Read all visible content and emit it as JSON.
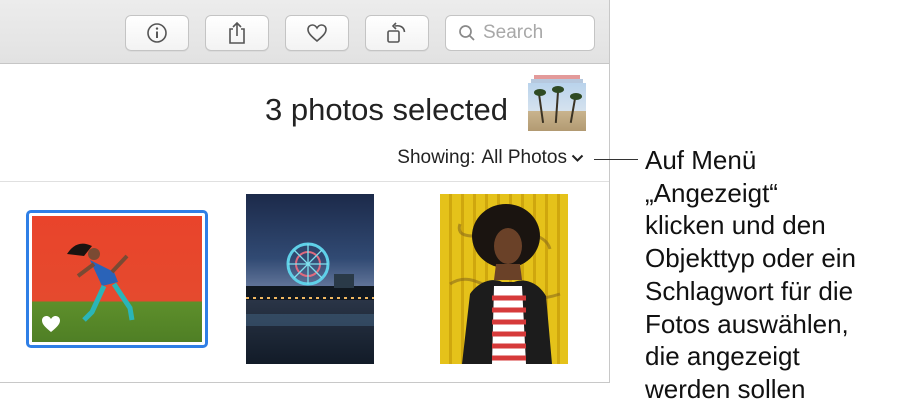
{
  "toolbar": {
    "buttons": [
      {
        "name": "info-button",
        "icon": "info-icon"
      },
      {
        "name": "share-button",
        "icon": "share-icon"
      },
      {
        "name": "favorite-button",
        "icon": "heart-icon"
      },
      {
        "name": "rotate-button",
        "icon": "rotate-icon"
      }
    ],
    "search": {
      "placeholder": "Search",
      "icon": "search-icon"
    }
  },
  "header": {
    "selection_title": "3 photos selected",
    "showing_label": "Showing:",
    "showing_value": "All Photos"
  },
  "photos": [
    {
      "subject": "dancer-red-wall",
      "selected": true,
      "favorite": true
    },
    {
      "subject": "pier-ferris-wheel-night",
      "selected": false,
      "favorite": false
    },
    {
      "subject": "woman-yellow-wall",
      "selected": false,
      "favorite": false
    }
  ],
  "callout": {
    "lines": [
      "Auf Menü",
      "„Angezeigt“",
      "klicken und den",
      "Objekttyp oder ein",
      "Schlagwort für die",
      "Fotos auswählen,",
      "die angezeigt",
      "werden sollen"
    ]
  },
  "colors": {
    "selection_border": "#2f7fe6",
    "toolbar_bg": "#e6e6e6"
  }
}
